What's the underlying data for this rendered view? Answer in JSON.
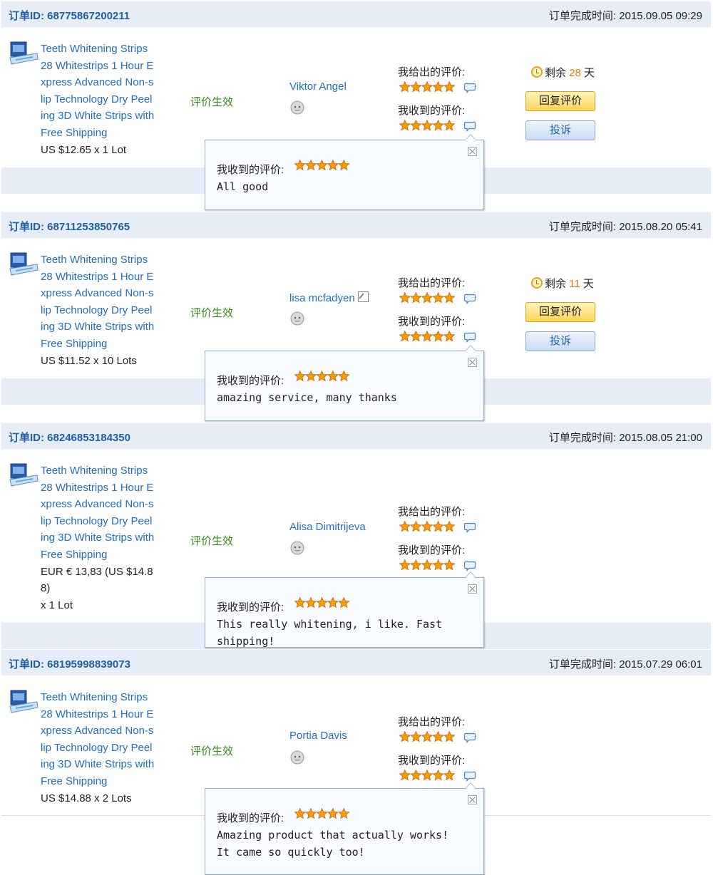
{
  "labels": {
    "order_id_prefix": "订单ID: ",
    "complete_time_prefix": "订单完成时间: ",
    "feedback_given": "我给出的评价:",
    "feedback_received": "我收到的评价:",
    "status": "评价生效",
    "remain_prefix": "剩余",
    "remain_suffix": "天",
    "reply_button": "回复评价",
    "complain_button": "投诉",
    "popup_label": "我收到的评价:"
  },
  "colors": {
    "link": "#1f6fbf",
    "status_green": "#3a8a1c",
    "days_orange": "#e67800",
    "header_bg": "#e6edf7",
    "star": "#f49b10"
  },
  "orders": [
    {
      "order_id": "68775867200211",
      "complete_time": "2015.09.05 09:29",
      "product_lines": [
        "Teeth Whitening Strips",
        "28 Whitestrips 1 Hour E",
        "xpress Advanced Non-s",
        "lip Technology Dry Peel",
        "ing 3D White Strips with",
        "Free Shipping"
      ],
      "price_lines": [
        "US $12.65 x 1 Lot"
      ],
      "buyer": "Viktor Angel",
      "buyer_edit_icon": false,
      "given_stars": 5,
      "received_stars": 5,
      "remaining_days": "28",
      "popup_stars": 5,
      "popup_text": "All good"
    },
    {
      "order_id": "68711253850765",
      "complete_time": "2015.08.20 05:41",
      "product_lines": [
        "Teeth Whitening Strips",
        "28 Whitestrips 1 Hour E",
        "xpress Advanced Non-s",
        "lip Technology Dry Peel",
        "ing 3D White Strips with",
        "Free Shipping"
      ],
      "price_lines": [
        "US $11.52 x 10 Lots"
      ],
      "buyer": "lisa mcfadyen",
      "buyer_edit_icon": true,
      "given_stars": 5,
      "received_stars": 5,
      "remaining_days": "11",
      "popup_stars": 5,
      "popup_text": "amazing service, many thanks"
    },
    {
      "order_id": "68246853184350",
      "complete_time": "2015.08.05 21:00",
      "product_lines": [
        "Teeth Whitening Strips",
        "28 Whitestrips 1 Hour E",
        "xpress Advanced Non-s",
        "lip Technology Dry Peel",
        "ing 3D White Strips with",
        "Free Shipping"
      ],
      "price_lines": [
        "EUR € 13,83 (US $14.8",
        "8)",
        "x 1 Lot"
      ],
      "buyer": "Alisa Dimitrijeva",
      "buyer_edit_icon": false,
      "given_stars": 5,
      "received_stars": 5,
      "remaining_days": null,
      "popup_stars": 5,
      "popup_text": "This really whitening, i like. Fast shipping!"
    },
    {
      "order_id": "68195998839073",
      "complete_time": "2015.07.29 06:01",
      "product_lines": [
        "Teeth Whitening Strips",
        "28 Whitestrips 1 Hour E",
        "xpress Advanced Non-s",
        "lip Technology Dry Peel",
        "ing 3D White Strips with",
        "Free Shipping"
      ],
      "price_lines": [
        "US $14.88 x 2 Lots"
      ],
      "buyer": "Portia Davis",
      "buyer_edit_icon": false,
      "given_stars": 5,
      "received_stars": 5,
      "remaining_days": null,
      "popup_stars": 5,
      "popup_text": "Amazing product that actually works! It came so quickly too!"
    }
  ]
}
